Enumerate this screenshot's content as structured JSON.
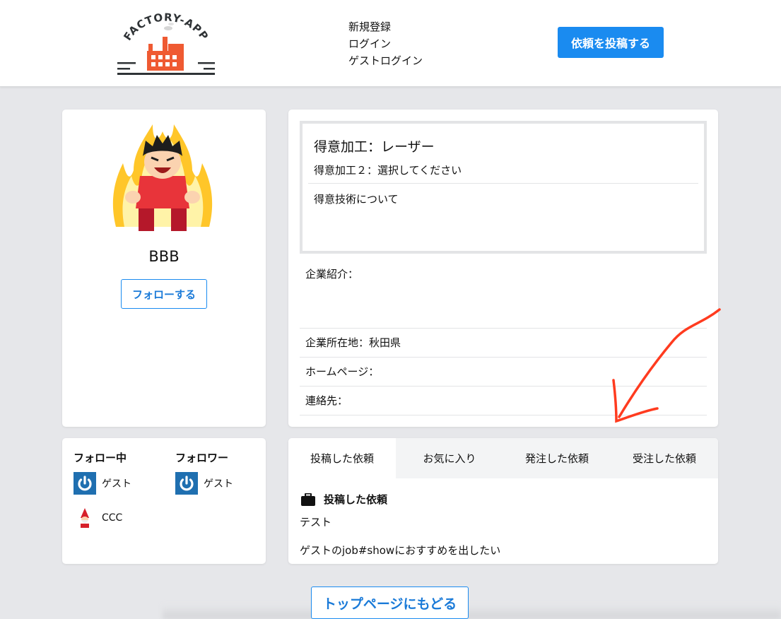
{
  "header": {
    "logo_text": "FACTORY-APP",
    "auth_links": [
      "新規登録",
      "ログイン",
      "ゲストログイン"
    ],
    "post_button_label": "依頼を投稿する"
  },
  "profile": {
    "username": "BBB",
    "follow_button_label": "フォローする"
  },
  "details": {
    "skill_main": "得意加工：レーザー",
    "skill_sub": "得意加工２：選択してください",
    "skill_about": "得意技術について",
    "company_intro": "企業紹介：",
    "company_location": "企業所在地：秋田県",
    "homepage": "ホームページ：",
    "contact": "連絡先："
  },
  "follows": {
    "following_title": "フォロー中",
    "followers_title": "フォロワー",
    "following": [
      "ゲスト",
      "CCC"
    ],
    "followers": [
      "ゲスト"
    ]
  },
  "requests": {
    "tabs": [
      "投稿した依頼",
      "お気に入り",
      "発注した依頼",
      "受注した依頼"
    ],
    "active_tab": 0,
    "section_title": "投稿した依頼",
    "items": [
      "テスト",
      "ゲストのjob#showにおすすめを出したい"
    ]
  },
  "back_button_label": "トップページにもどる",
  "colors": {
    "accent": "#1a8bf0",
    "background": "#e6e7ea",
    "annotation": "#ff3b1f"
  }
}
